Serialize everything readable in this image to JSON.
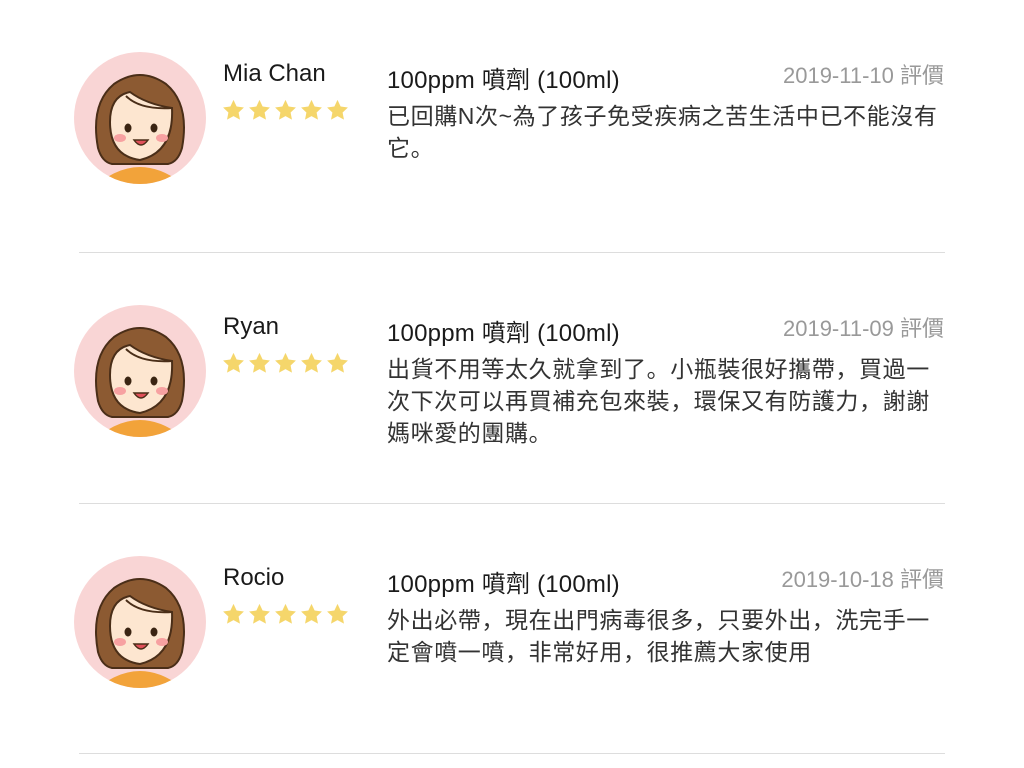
{
  "reviews": [
    {
      "name": "Mia Chan",
      "rating": 5,
      "product": "100ppm 噴劑 (100ml)",
      "date": "2019-11-10 評價",
      "text": "已回購N次~為了孩子免受疾病之苦生活中已不能沒有它。"
    },
    {
      "name": "Ryan",
      "rating": 5,
      "product": "100ppm 噴劑 (100ml)",
      "date": "2019-11-09 評價",
      "text": "出貨不用等太久就拿到了。小瓶裝很好攜帶，買過一次下次可以再買補充包來裝，環保又有防護力，謝謝媽咪愛的團購。"
    },
    {
      "name": "Rocio",
      "rating": 5,
      "product": "100ppm 噴劑 (100ml)",
      "date": "2019-10-18 評價",
      "text": "外出必帶，現在出門病毒很多，只要外出，洗完手一定會噴一噴，非常好用，很推薦大家使用"
    }
  ],
  "colors": {
    "star": "#f5d66b",
    "avatar_bg": "#f9d5d5",
    "hair": "#8c5a32",
    "skin": "#fde6d0",
    "shirt": "#f2a33a",
    "divider": "#dddddd",
    "date_text": "#999999"
  },
  "icons": {
    "avatar": "girl-avatar-icon",
    "star": "star-icon"
  }
}
